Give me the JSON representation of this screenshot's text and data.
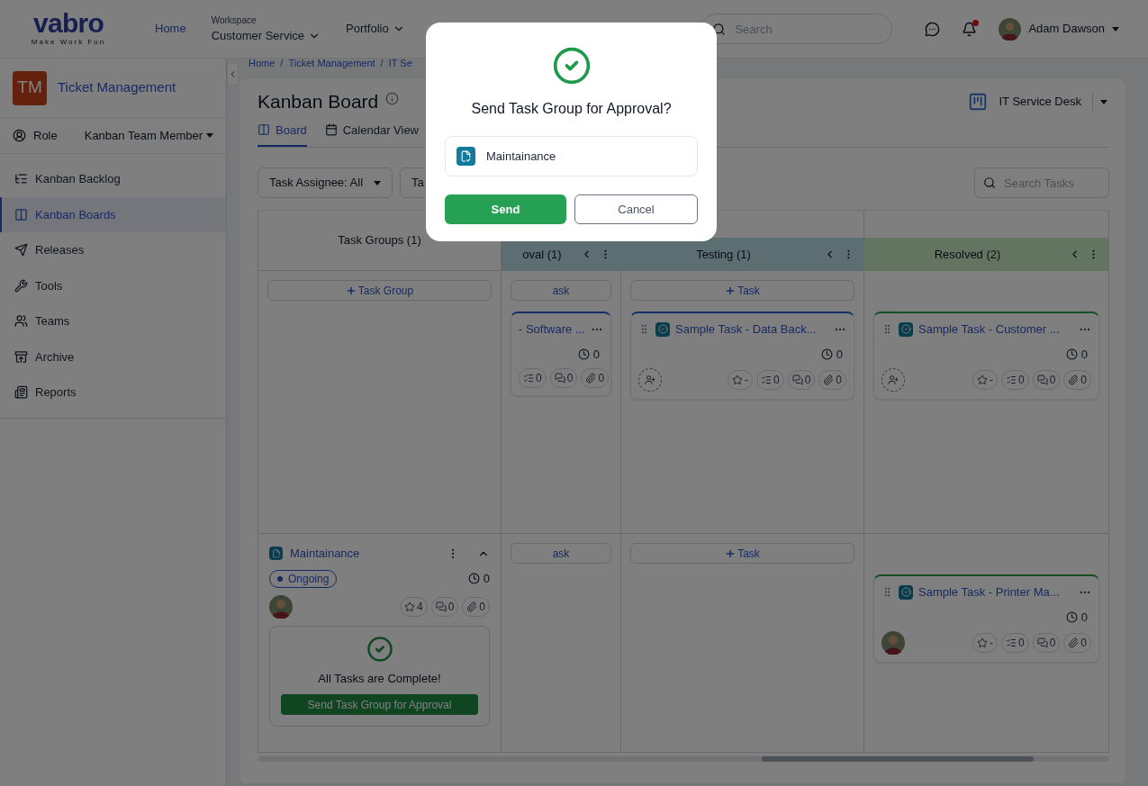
{
  "header": {
    "logo": {
      "name": "vabro",
      "tagline": "Make Work Fun"
    },
    "nav": [
      {
        "kind": "link",
        "label": "Home",
        "selected": true
      },
      {
        "kind": "workspace",
        "caption": "Workspace",
        "label": "Customer Service",
        "selected": false
      },
      {
        "kind": "menu",
        "label": "Portfolio",
        "selected": false
      }
    ],
    "search": {
      "placeholder": "Search"
    },
    "notifications": {
      "unread": true
    },
    "user": {
      "name": "Adam Dawson"
    }
  },
  "sidebar": {
    "project": {
      "initials": "TM",
      "name": "Ticket Management"
    },
    "role": {
      "label": "Role",
      "value": "Kanban Team Member"
    },
    "items": [
      {
        "kind": "backlog",
        "label": "Kanban Backlog",
        "selected": false
      },
      {
        "kind": "boards",
        "label": "Kanban Boards",
        "selected": true
      },
      {
        "kind": "releases",
        "label": "Releases",
        "selected": false
      },
      {
        "kind": "tools",
        "label": "Tools",
        "selected": false
      },
      {
        "kind": "teams",
        "label": "Teams",
        "selected": false
      },
      {
        "kind": "archive",
        "label": "Archive",
        "selected": false
      },
      {
        "kind": "reports",
        "label": "Reports",
        "selected": false
      }
    ]
  },
  "breadcrumb": {
    "separator": "/",
    "items": [
      "Home",
      "Ticket Management",
      "IT Se"
    ]
  },
  "board": {
    "title": "Kanban Board",
    "selector": "IT Service Desk",
    "tabs": [
      {
        "kind": "board",
        "label": "Board",
        "selected": true
      },
      {
        "kind": "calendar",
        "label": "Calendar View",
        "selected": false
      }
    ],
    "filters": [
      {
        "label": "Task Assignee: All",
        "caret": true
      },
      {
        "label": "Ta",
        "caret": false
      }
    ],
    "search": {
      "placeholder": "Search Tasks"
    },
    "group_column": {
      "title": "Task Groups (1)"
    },
    "columns": [
      {
        "kind": "review",
        "title": "oval (1)"
      },
      {
        "kind": "testing",
        "title": "Testing (1)"
      },
      {
        "kind": "resolved",
        "title": "Resolved (2)"
      }
    ],
    "lanes": [
      {
        "group": {
          "kind": "add",
          "add_label": "Task Group"
        },
        "cells": [
          {
            "add_label": "ask",
            "cards": [
              {
                "title": "- Software ...",
                "kind": "open",
                "icon": false,
                "time": "0",
                "chips": [
                  {
                    "kind": "checklist",
                    "value": "0"
                  },
                  {
                    "kind": "comments",
                    "value": "0"
                  },
                  {
                    "kind": "attachments",
                    "value": "0"
                  }
                ]
              }
            ]
          },
          {
            "add_label": "Task",
            "cards": [
              {
                "title": "Sample Task - Data Back...",
                "kind": "open",
                "icon": true,
                "time": "0",
                "assigned": false,
                "chips": [
                  {
                    "kind": "rating",
                    "value": "-"
                  },
                  {
                    "kind": "checklist",
                    "value": "0"
                  },
                  {
                    "kind": "comments",
                    "value": "0"
                  },
                  {
                    "kind": "attachments",
                    "value": "0"
                  }
                ]
              }
            ]
          },
          {
            "cards": [
              {
                "title": "Sample Task - Customer ...",
                "kind": "done",
                "icon": true,
                "time": "0",
                "assigned": false,
                "chips": [
                  {
                    "kind": "rating",
                    "value": "-"
                  },
                  {
                    "kind": "checklist",
                    "value": "0"
                  },
                  {
                    "kind": "comments",
                    "value": "0"
                  },
                  {
                    "kind": "attachments",
                    "value": "0"
                  }
                ]
              }
            ]
          }
        ]
      },
      {
        "group": {
          "kind": "group",
          "title": "Maintainance",
          "status": "Ongoing",
          "time": "0",
          "expanded": true,
          "chips": [
            {
              "kind": "rating",
              "value": "4"
            },
            {
              "kind": "comments",
              "value": "0"
            },
            {
              "kind": "attachments",
              "value": "0"
            }
          ],
          "complete": {
            "message": "All Tasks are Complete!",
            "action": "Send Task Group for Approval"
          }
        },
        "cells": [
          {
            "add_label": "ask"
          },
          {
            "add_label": "Task"
          },
          {
            "cards": [
              {
                "title": "Sample Task - Printer Ma...",
                "kind": "done",
                "icon": true,
                "time": "0",
                "assigned": true,
                "chips": [
                  {
                    "kind": "rating",
                    "value": "-"
                  },
                  {
                    "kind": "checklist",
                    "value": "0"
                  },
                  {
                    "kind": "comments",
                    "value": "0"
                  },
                  {
                    "kind": "attachments",
                    "value": "0"
                  }
                ]
              }
            ]
          }
        ]
      }
    ]
  },
  "modal": {
    "open": true,
    "title": "Send Task Group for Approval?",
    "item": "Maintainance",
    "confirm": "Send",
    "cancel": "Cancel"
  }
}
